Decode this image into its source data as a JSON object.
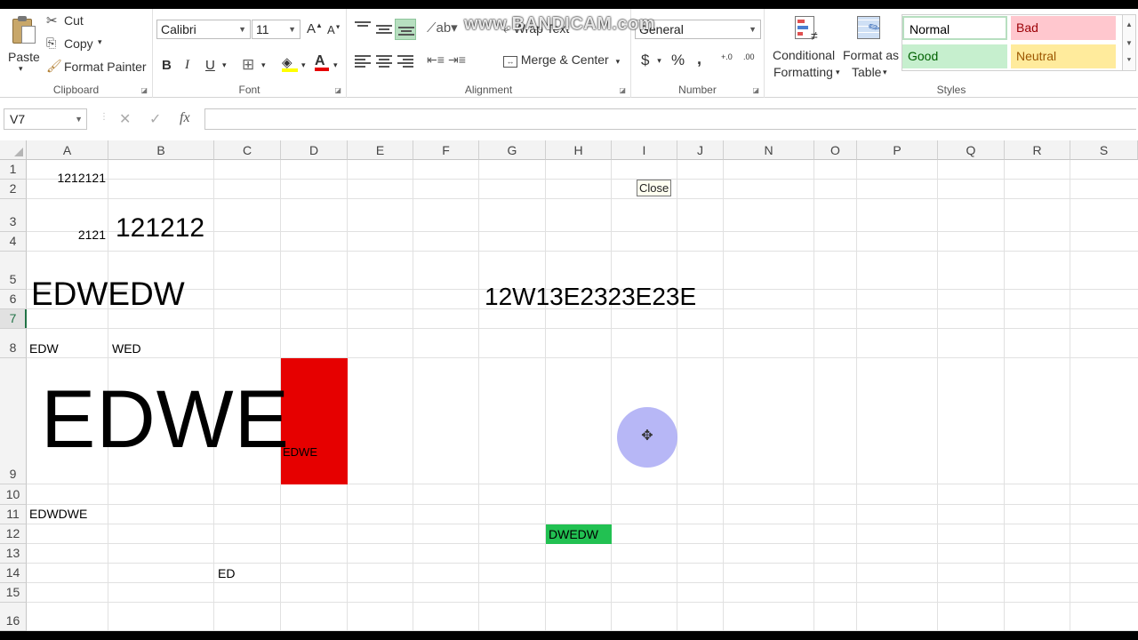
{
  "ribbon": {
    "clipboard": {
      "paste": "Paste",
      "cut": "Cut",
      "copy": "Copy",
      "format_painter": "Format Painter",
      "label": "Clipboard"
    },
    "font": {
      "name": "Calibri",
      "size": "11",
      "bold": "B",
      "italic": "I",
      "underline": "U",
      "label": "Font"
    },
    "alignment": {
      "wrap_text": "Wrap Text",
      "merge_center": "Merge & Center",
      "label": "Alignment"
    },
    "number": {
      "format": "General",
      "currency": "$",
      "percent": "%",
      "comma": ",",
      "inc_decimal": "+.0",
      "dec_decimal": ".00",
      "label": "Number"
    },
    "styles": {
      "conditional_line1": "Conditional",
      "conditional_line2": "Formatting",
      "format_table_line1": "Format as",
      "format_table_line2": "Table",
      "normal": "Normal",
      "bad": "Bad",
      "good": "Good",
      "neutral": "Neutral",
      "label": "Styles"
    }
  },
  "formula_bar": {
    "name_box": "V7",
    "formula": ""
  },
  "columns": [
    "A",
    "B",
    "C",
    "D",
    "E",
    "F",
    "G",
    "H",
    "I",
    "J",
    "N",
    "O",
    "P",
    "Q",
    "R",
    "S"
  ],
  "rows": [
    "1",
    "2",
    "3",
    "4",
    "5",
    "6",
    "7",
    "8",
    "9",
    "10",
    "11",
    "12",
    "13",
    "14",
    "15",
    "16"
  ],
  "cells": {
    "A1": "1212121",
    "A3": "2121",
    "B3": "121212",
    "A5": "EDWEDW",
    "G5": "12W13E2323E23E",
    "A7": "EDW",
    "B7": "WED",
    "A8": "EDWE",
    "D8": "EDWE",
    "A10": "EDWDWE",
    "H11": "DWEDW",
    "C13": "ED"
  },
  "tooltip": "Close",
  "watermark": "www.BANDICAM.com",
  "colors": {
    "red_fill": "#e60000",
    "green_fill": "#22c152",
    "selected_row_accent": "#217346",
    "style_bad": "#ffc7ce",
    "style_good": "#c6efce",
    "style_neutral": "#ffeb9c",
    "cursor_highlight": "#aaaaf5"
  }
}
